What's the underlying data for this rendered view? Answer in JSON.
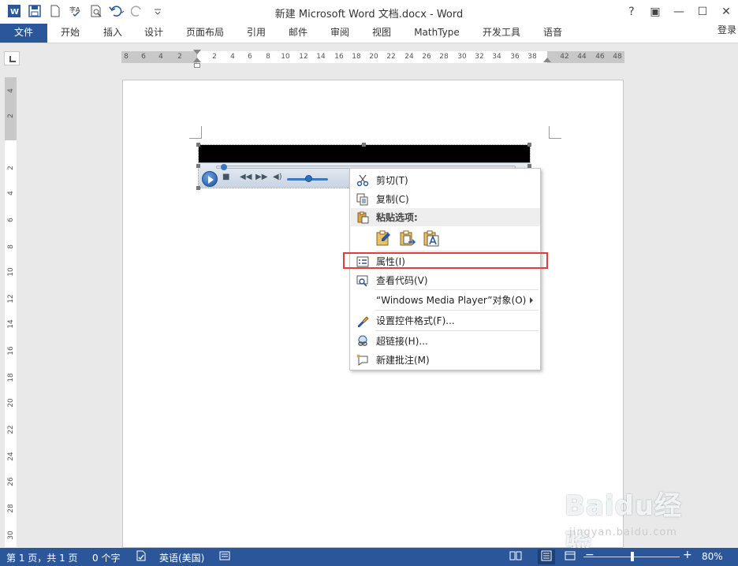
{
  "window": {
    "title": "新建 Microsoft Word 文档.docx - Word",
    "help": "?",
    "restore_ribbon": "▣",
    "minimize": "—",
    "maximize": "☐",
    "close": "✕"
  },
  "ribbon": {
    "tabs": [
      "文件",
      "开始",
      "插入",
      "设计",
      "页面布局",
      "引用",
      "邮件",
      "审阅",
      "视图",
      "MathType",
      "开发工具",
      "语音"
    ],
    "login": "登录"
  },
  "ruler": {
    "h_ticks": [
      "8",
      "6",
      "4",
      "2",
      "2",
      "4",
      "6",
      "8",
      "10",
      "12",
      "14",
      "16",
      "18",
      "20",
      "22",
      "24",
      "26",
      "28",
      "30",
      "32",
      "34",
      "36",
      "38",
      "42",
      "44",
      "46",
      "48"
    ],
    "v_ticks": [
      "4",
      "2",
      "2",
      "4",
      "6",
      "8",
      "10",
      "12",
      "14",
      "16",
      "18",
      "20",
      "22",
      "24",
      "26",
      "28",
      "30"
    ]
  },
  "context_menu": {
    "items": [
      {
        "label": "剪切(T)",
        "icon": "scissors-icon"
      },
      {
        "label": "复制(C)",
        "icon": "copy-icon"
      },
      {
        "label": "粘贴选项:",
        "icon": "paste-icon"
      },
      {
        "label": "属性(I)",
        "icon": "properties-icon"
      },
      {
        "label": "查看代码(V)",
        "icon": "view-code-icon"
      },
      {
        "label": "“Windows Media Player”对象(O)",
        "icon": ""
      },
      {
        "label": "设置控件格式(F)...",
        "icon": "format-control-icon"
      },
      {
        "label": "超链接(H)...",
        "icon": "hyperlink-icon"
      },
      {
        "label": "新建批注(M)",
        "icon": "new-comment-icon"
      }
    ],
    "paste_options": [
      "keep-source-formatting-icon",
      "merge-formatting-icon",
      "keep-text-only-icon"
    ],
    "highlight_color": "#e43c3c"
  },
  "statusbar": {
    "page": "第 1 页，共 1 页",
    "words": "0 个字",
    "language": "英语(美国)",
    "zoom": "80%",
    "zoom_out": "−",
    "zoom_in": "+"
  },
  "watermark": {
    "logo": "Baidu经验",
    "url": "jingyan.baidu.com"
  },
  "colors": {
    "accent": "#2b579a",
    "highlight": "#e43c3c"
  }
}
